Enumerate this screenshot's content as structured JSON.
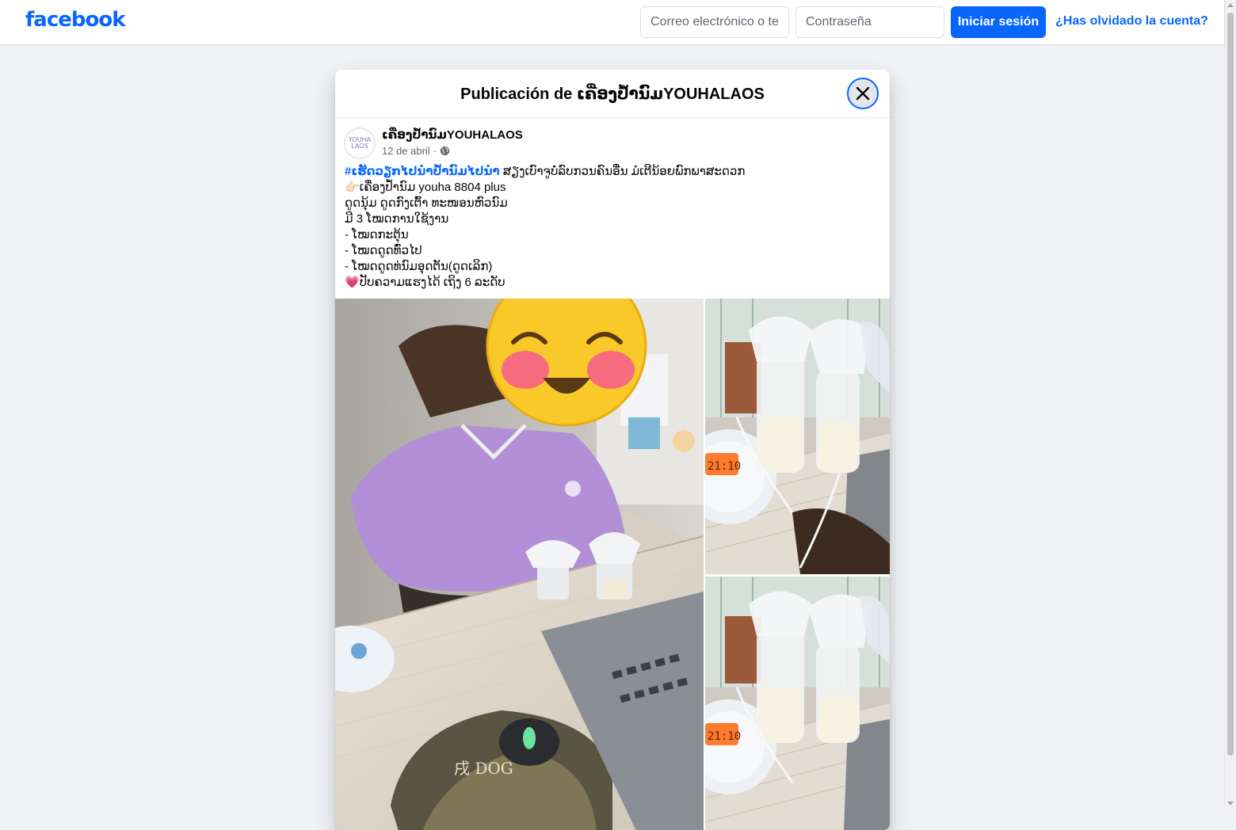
{
  "topbar": {
    "logo": "facebook",
    "email_placeholder": "Correo electrónico o teléfono",
    "password_placeholder": "Contraseña",
    "login_label": "Iniciar sesión",
    "forgot_label": "¿Has olvidado la cuenta?"
  },
  "dialog": {
    "title": "Publicación de ເຄື່ອງປ້ຳນົມYOUHALAOS",
    "close_icon": "close-icon"
  },
  "post": {
    "page_name": "ເຄື່ອງປ້ຳນົມYOUHALAOS",
    "avatar_text": "YOUHA LAOS",
    "date": "12 de abril",
    "separator": "·",
    "audience_icon": "globe-icon",
    "hashtag": "#ເຮັດວຽກໄປນຳປ້ຳນົມໄປນຳ",
    "line1_rest": " ສຽງເບົາຈູບໍ່ລົບກວນຄົນອື່ນ ມໍເຕີນ້ອຍພົກພາສະດວກ",
    "line2_emoji": "👉🏻",
    "line2": "ເຄື່ອງປ້ຳນົມ youha 8804 plus",
    "line3": "ດູດນຸ້ມ ດູດກົງເຕົ້າ ທະໜອນຫົວນົມ",
    "line4": "ມີ 3 ໂໝດການໃຊ້ງານ",
    "line5": "- ໂໝດກະຕຸ້ນ",
    "line6": "- ໂໝດດູດທົ່ວໄປ",
    "line7": "- ໂໝດດູດທ່ນົມອຸດຕັນ(ດູດເລິກ)",
    "line8_emoji": "💗",
    "line8": "ປັບຄວາມແຮງໄດ້ ເຖິງ 6 ລະດັບ"
  },
  "photos": {
    "main_label": "photo-woman-breast-pump",
    "top_label": "photo-breast-pump-bottles-1",
    "bottom_label": "photo-breast-pump-bottles-2",
    "display_time": "21:10",
    "mousepad_text": "戌 DOG"
  }
}
